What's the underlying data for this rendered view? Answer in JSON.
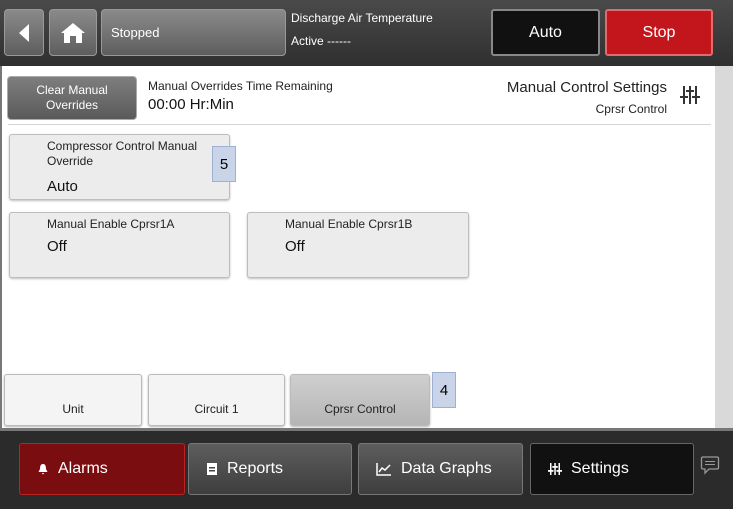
{
  "topbar": {
    "status": "Stopped",
    "dat_title": "Discharge Air Temperature",
    "dat_active": "Active ------",
    "auto_label": "Auto",
    "stop_label": "Stop"
  },
  "header": {
    "clear_label": "Clear Manual Overrides",
    "mo_label": "Manual Overrides Time Remaining",
    "mo_value": "00:00 Hr:Min",
    "mcs_title": "Manual Control Settings",
    "mcs_sub": "Cprsr Control"
  },
  "cards": {
    "compressor": {
      "label": "Compressor Control Manual Override",
      "value": "Auto",
      "badge": "5"
    },
    "enable_a": {
      "label": "Manual Enable Cprsr1A",
      "value": "Off"
    },
    "enable_b": {
      "label": "Manual Enable Cprsr1B",
      "value": "Off"
    }
  },
  "tabs": [
    {
      "label": "Unit"
    },
    {
      "label": "Circuit 1"
    },
    {
      "label": "Cprsr Control"
    }
  ],
  "tabs_badge": "4",
  "nav": {
    "alarms": "Alarms",
    "reports": "Reports",
    "graphs": "Data Graphs",
    "settings": "Settings"
  },
  "colors": {
    "stop": "#c3161c",
    "alarms": "#7a0d0f",
    "badge": "#c9d4e8"
  }
}
